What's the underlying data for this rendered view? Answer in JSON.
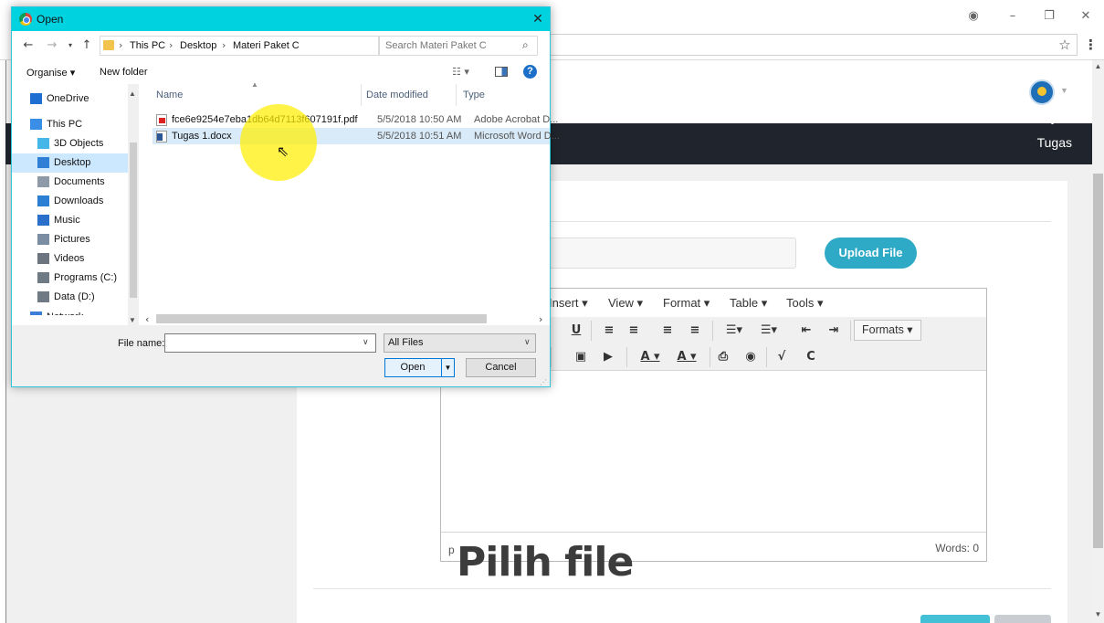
{
  "browser": {
    "account_icon": "account-icon",
    "minimize_glyph": "–",
    "restore_glyph": "❐",
    "close_glyph": "✕",
    "star_glyph": "☆",
    "menu_glyph": "⋮"
  },
  "page": {
    "nav_item": "Tugas",
    "upload_label": "Upload File",
    "caption": "Pilih file",
    "accent_color": "#2eaac6"
  },
  "editor": {
    "menus": [
      "Insert ▾",
      "View ▾",
      "Format ▾",
      "Table ▾",
      "Tools ▾"
    ],
    "formats_label": "Formats ▾",
    "status_path": "p",
    "word_count": "Words: 0"
  },
  "dialog": {
    "title": "Open",
    "breadcrumb": [
      "This PC",
      "Desktop",
      "Materi Paket C"
    ],
    "search_placeholder": "Search Materi Paket C",
    "organise_label": "Organise ▾",
    "new_folder_label": "New folder",
    "sidebar": [
      {
        "label": "OneDrive",
        "icon": "cloud-icon"
      },
      {
        "label": "This PC",
        "icon": "computer-icon"
      },
      {
        "label": "3D Objects",
        "icon": "cube-icon"
      },
      {
        "label": "Desktop",
        "icon": "desktop-icon",
        "selected": true
      },
      {
        "label": "Documents",
        "icon": "documents-icon"
      },
      {
        "label": "Downloads",
        "icon": "downloads-icon"
      },
      {
        "label": "Music",
        "icon": "music-icon"
      },
      {
        "label": "Pictures",
        "icon": "pictures-icon"
      },
      {
        "label": "Videos",
        "icon": "videos-icon"
      },
      {
        "label": "Programs (C:)",
        "icon": "drive-icon"
      },
      {
        "label": "Data (D:)",
        "icon": "drive-icon"
      },
      {
        "label": "Network",
        "icon": "network-icon"
      }
    ],
    "columns": {
      "name": "Name",
      "date": "Date modified",
      "type": "Type"
    },
    "files": [
      {
        "name": "fce6e9254e7eba1db64d7113f607191f.pdf",
        "date": "5/5/2018 10:50 AM",
        "type": "Adobe Acrobat D...",
        "icon": "pdf-file-icon"
      },
      {
        "name": "Tugas 1.docx",
        "date": "5/5/2018 10:51 AM",
        "type": "Microsoft Word D...",
        "icon": "word-file-icon",
        "selected": true
      }
    ],
    "file_name_label": "File name:",
    "file_name_value": "",
    "file_type": "All Files",
    "open_label": "Open",
    "cancel_label": "Cancel"
  }
}
